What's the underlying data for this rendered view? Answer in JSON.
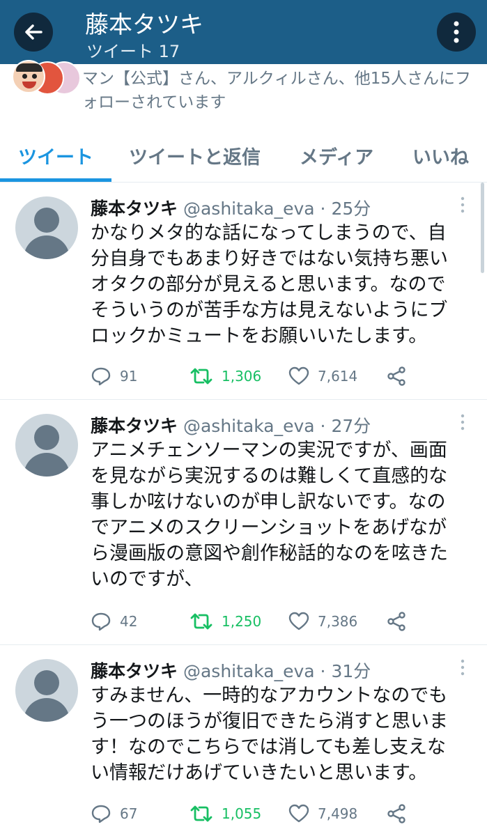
{
  "header": {
    "title": "藤本タツキ",
    "subtitle": "ツイート 17",
    "back_icon": "arrow-left-icon",
    "more_icon": "more-vertical-icon",
    "color": "#1c5e88"
  },
  "followed_by": {
    "text": "マン【公式】さん、アルクィルさん、他15人さんにフォローされています"
  },
  "tabs": [
    {
      "label": "ツイート",
      "active": true
    },
    {
      "label": "ツイートと返信"
    },
    {
      "label": "メディア"
    },
    {
      "label": "いいね"
    }
  ],
  "tweets": [
    {
      "name": "藤本タツキ",
      "handle": "@ashitaka_eva",
      "time": "· 25分",
      "lines": [
        "かなりメタ的な話になってしまうので、自",
        "分自身でもあまり好きではない気持ち悪い",
        "オタクの部分が見えると思います。なので",
        "そういうのが苦手な方は見えないようにブ",
        "ロックかミュートをお願いいたします。"
      ],
      "replies": "91",
      "retweets": "1,306",
      "likes": "7,614"
    },
    {
      "name": "藤本タツキ",
      "handle": "@ashitaka_eva",
      "time": "· 27分",
      "lines": [
        "アニメチェンソーマンの実況ですが、画面",
        "を見ながら実況するのは難しくて直感的な",
        "事しか呟けないのが申し訳ないです。なの",
        "でアニメのスクリーンショットをあげなが",
        "ら漫画版の意図や創作秘話的なのを呟きた",
        "いのですが、"
      ],
      "replies": "42",
      "retweets": "1,250",
      "likes": "7,386"
    },
    {
      "name": "藤本タツキ",
      "handle": "@ashitaka_eva",
      "time": "· 31分",
      "lines": [
        "すみません、一時的なアカウントなのでも",
        "う一つのほうが復旧できたら消すと思いま",
        "す！なのでこちらでは消しても差し支えな",
        "い情報だけあげていきたいと思います。"
      ],
      "replies": "67",
      "retweets": "1,055",
      "likes": "7,498"
    }
  ],
  "colors": {
    "accent": "#1b95e0",
    "retweet": "#17bf63",
    "muted": "#657786"
  }
}
